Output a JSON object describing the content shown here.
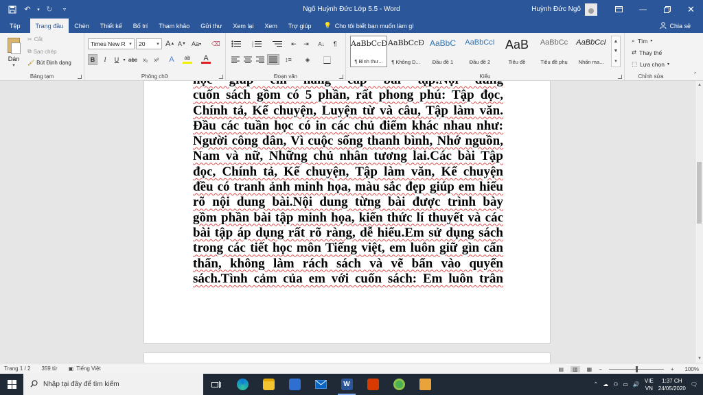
{
  "window": {
    "title": "Ngô Huỳnh Đức Lớp 5.5  -  Word",
    "user": "Huỳnh Đức Ngô"
  },
  "tabs": [
    "Tệp",
    "Trang đầu",
    "Chèn",
    "Thiết kế",
    "Bố trí",
    "Tham khảo",
    "Gửi thư",
    "Xem lại",
    "Xem",
    "Trợ giúp"
  ],
  "active_tab": "Trang đầu",
  "tell_me": "Cho tôi biết bạn muốn làm gì",
  "share": "Chia sẻ",
  "ribbon": {
    "clipboard": {
      "label": "Bảng tạm",
      "paste": "Dán",
      "cut": "Cắt",
      "copy": "Sao chép",
      "format_painter": "Bút Định dạng"
    },
    "font": {
      "label": "Phông chữ",
      "font_name": "Times New R",
      "font_size": "20",
      "grow": "A",
      "shrink": "A",
      "case": "Aa",
      "bold": "B",
      "italic": "I",
      "underline": "U",
      "strike": "abc",
      "subscript": "x₂",
      "superscript": "x²",
      "effects": "A",
      "highlight": "ab",
      "color": "A"
    },
    "paragraph": {
      "label": "Đoạn văn",
      "show_marks": "¶"
    },
    "styles": {
      "label": "Kiểu",
      "items": [
        {
          "sample": "AaBbCcĐ",
          "name": "¶ Bình thư..."
        },
        {
          "sample": "AaBbCcĐ",
          "name": "¶ Không D..."
        },
        {
          "sample": "AaBbC",
          "name": "Đầu đề 1"
        },
        {
          "sample": "AaBbCcI",
          "name": "Đầu đề 2"
        },
        {
          "sample": "AaB",
          "name": "Tiêu đề"
        },
        {
          "sample": "AaBbCc",
          "name": "Tiêu đề phụ"
        },
        {
          "sample": "AaBbCcI",
          "name": "Nhấn ma..."
        }
      ]
    },
    "editing": {
      "label": "Chỉnh sửa",
      "find": "Tìm",
      "replace": "Thay thế",
      "select": "Lựa chọn"
    }
  },
  "document": {
    "lines": [
      "học giúp em nâng cấp bài tập.Nội dung",
      "cuốn sách gồm có 5 phần, rất phong phú: Tập đọc,",
      "Chính tả, Kể chuyện, Luyện từ và câu, Tập làm văn.",
      "Đầu các tuần học có in các chủ điểm khác nhau như:",
      "Người công dân, Vì cuộc sống thanh bình, Nhớ nguồn,",
      "Nam và nữ, Những chủ nhân tương lai.Các bài Tập",
      "đọc, Chính tả, Kể chuyện, Tập làm văn, Kể chuyện",
      "đều có tranh ảnh minh họa, màu sắc đẹp giúp em hiểu",
      "rõ nội dung bài.Nội dung từng bài được trình bày",
      "gồm phần bài tập minh họa, kiến thức lí thuyết và các",
      "bài tập áp dụng rất rõ ràng, dễ hiểu.Em sử dụng sách",
      "trong các tiết học môn Tiếng việt, em luôn giữ gìn cẩn",
      "thẩn, không làm rách sách và vẽ bẩn vào quyển",
      "sách.Tình cảm của em với cuốn sách: Em luôn trân"
    ]
  },
  "status": {
    "page": "Trang 1 / 2",
    "words": "359 từ",
    "language": "Tiếng Việt",
    "zoom": "100%",
    "zoom_minus": "−",
    "zoom_plus": "+"
  },
  "taskbar": {
    "search_placeholder": "Nhập tại đây để tìm kiếm",
    "lang_line1": "VIE",
    "lang_line2": "VN",
    "time": "1:37 CH",
    "date": "24/05/2020"
  },
  "colors": {
    "word_blue": "#2b579a",
    "ribbon_bg": "#f3f3f3",
    "taskbar_bg": "#1f2a36",
    "spell_underline": "#e05050"
  }
}
